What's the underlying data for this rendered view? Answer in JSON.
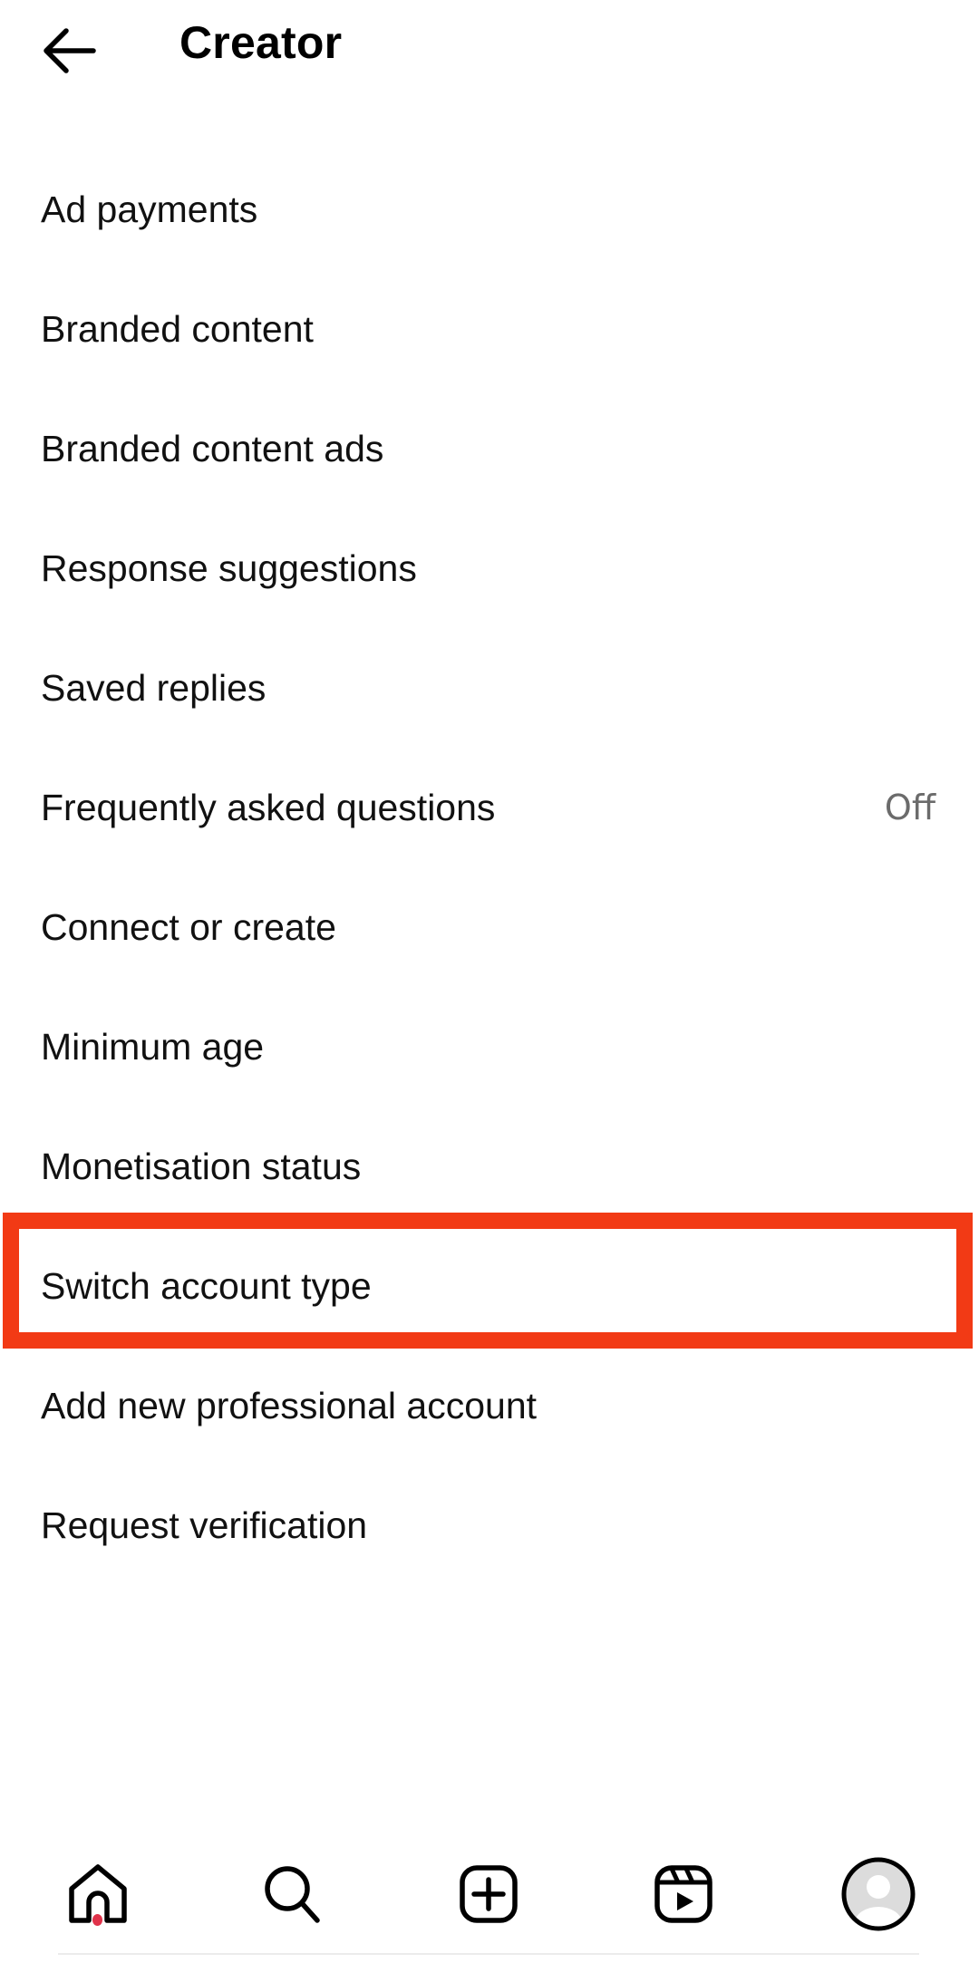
{
  "header": {
    "title": "Creator",
    "back_icon": "arrow-left-icon"
  },
  "menu": {
    "items": [
      {
        "label": "Ad payments",
        "value": null
      },
      {
        "label": "Branded content",
        "value": null
      },
      {
        "label": "Branded content ads",
        "value": null
      },
      {
        "label": "Response suggestions",
        "value": null
      },
      {
        "label": "Saved replies",
        "value": null
      },
      {
        "label": "Frequently asked questions",
        "value": "Off"
      },
      {
        "label": "Connect or create",
        "value": null
      },
      {
        "label": "Minimum age",
        "value": null
      },
      {
        "label": "Monetisation status",
        "value": null
      },
      {
        "label": "Switch account type",
        "value": null,
        "highlighted": true
      },
      {
        "label": "Add new professional account",
        "value": null
      },
      {
        "label": "Request verification",
        "value": null
      }
    ]
  },
  "highlight": {
    "color": "#f23a15",
    "target": "Switch account type"
  },
  "bottom_nav": {
    "items": [
      {
        "name": "home",
        "icon": "home-icon",
        "has_notification_dot": true
      },
      {
        "name": "search",
        "icon": "search-icon"
      },
      {
        "name": "create",
        "icon": "plus-square-icon"
      },
      {
        "name": "reels",
        "icon": "reels-icon"
      },
      {
        "name": "profile",
        "icon": "avatar-icon"
      }
    ],
    "notification_dot_color": "#e0324a"
  }
}
